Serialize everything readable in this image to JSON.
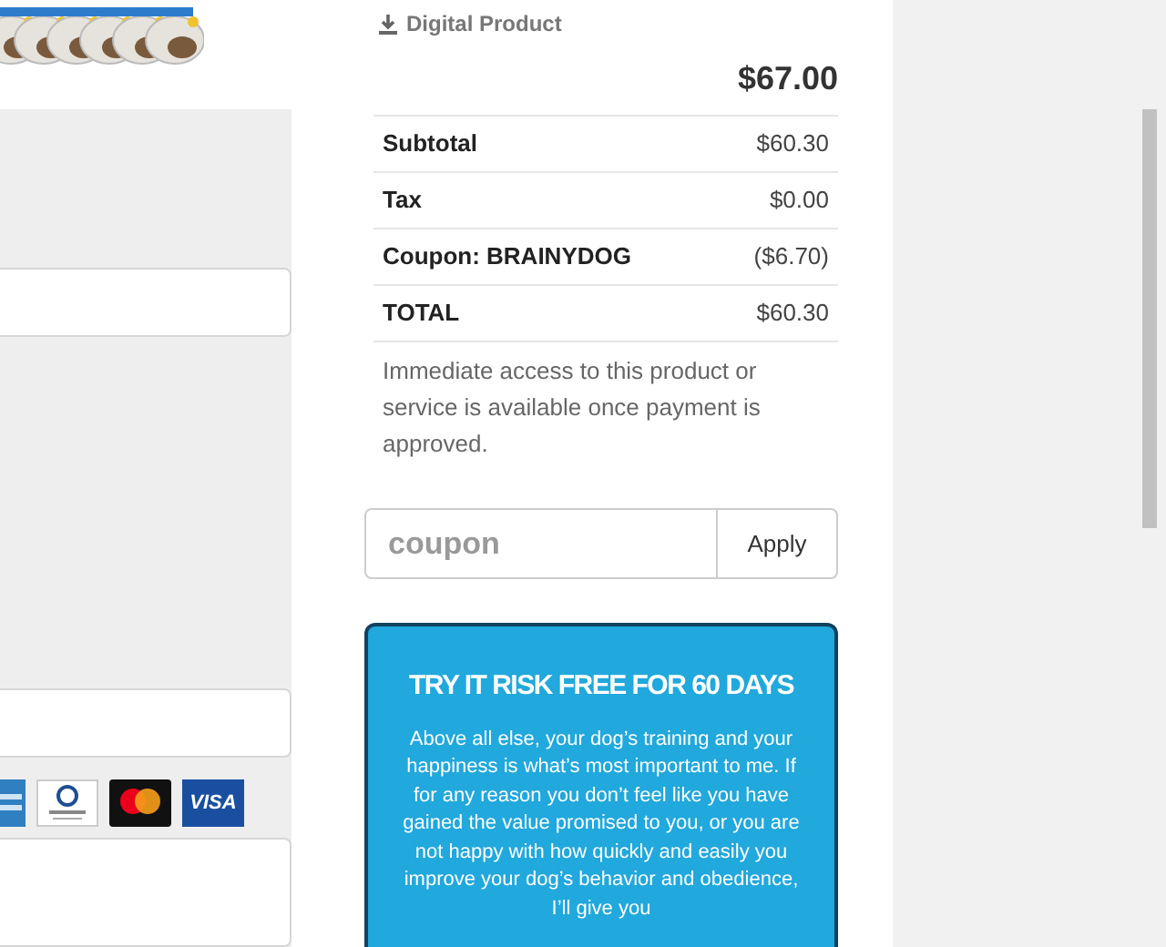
{
  "product": {
    "delivery": "Digital Product",
    "price": "$67.00"
  },
  "summary": [
    {
      "label": "Subtotal",
      "value": "$60.30"
    },
    {
      "label": "Tax",
      "value": "$0.00"
    },
    {
      "label": "Coupon: BRAINYDOG",
      "value": "($6.70)"
    },
    {
      "label": "TOTAL",
      "value": "$60.30"
    }
  ],
  "access_note": "Immediate access to this product or service is available once payment is approved.",
  "coupon": {
    "placeholder": "coupon",
    "button": "Apply"
  },
  "guarantee": {
    "title": "TRY IT RISK FREE FOR 60 DAYS",
    "body": "Above all else, your dog’s training and your happiness is what’s most important to me. If for any reason you don’t feel like you have gained the value promised to you, or you are not happy with how quickly and easily you improve your dog’s behavior and obedience, I’ll give you"
  },
  "cards": [
    {
      "kind": "amex"
    },
    {
      "kind": "diners"
    },
    {
      "kind": "mastercard"
    },
    {
      "kind": "visa",
      "label": "VISA"
    }
  ]
}
